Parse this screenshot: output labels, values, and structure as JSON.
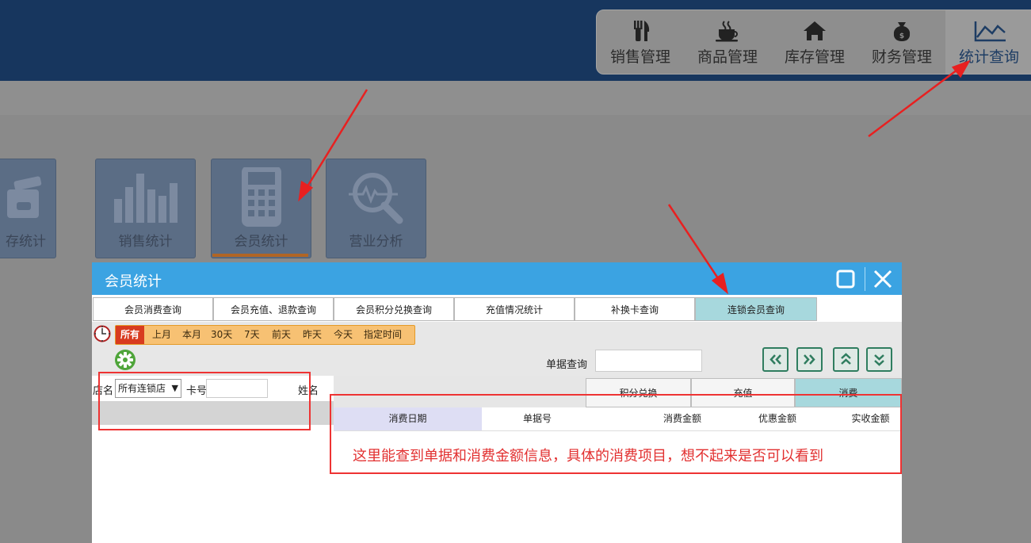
{
  "main_nav": {
    "items": [
      {
        "label": "销售管理",
        "icon": "fork-knife-icon"
      },
      {
        "label": "商品管理",
        "icon": "coffee-cup-icon"
      },
      {
        "label": "库存管理",
        "icon": "house-icon"
      },
      {
        "label": "财务管理",
        "icon": "money-bag-icon"
      },
      {
        "label": "统计查询",
        "icon": "line-chart-icon"
      }
    ],
    "active": "统计查询"
  },
  "tiles": [
    {
      "label": "存统计",
      "icon": "wallet-icon"
    },
    {
      "label": "销售统计",
      "icon": "bar-chart-icon"
    },
    {
      "label": "会员统计",
      "icon": "calculator-icon"
    },
    {
      "label": "营业分析",
      "icon": "magnifier-pulse-icon"
    }
  ],
  "window": {
    "title": "会员统计",
    "tabs": [
      "会员消费查询",
      "会员充值、退款查询",
      "会员积分兑换查询",
      "充值情况统计",
      "补换卡查询",
      "连锁会员查询"
    ],
    "active_tab": "连锁会员查询",
    "date_filters": [
      "所有",
      "上月",
      "本月",
      "30天",
      "7天",
      "前天",
      "昨天",
      "今天",
      "指定时间"
    ],
    "active_date": "所有",
    "search": {
      "label": "单据查询",
      "value": ""
    },
    "nav_buttons": [
      "<<",
      ">>",
      "top",
      "bottom"
    ],
    "filter": {
      "store_label": "店名",
      "store_value": "所有连锁店",
      "card_label": "卡号",
      "card_value": "",
      "name_label": "姓名"
    },
    "sub_tabs": [
      "积分兑换",
      "充值",
      "消费"
    ],
    "active_sub_tab": "消费",
    "columns": [
      "消费日期",
      "单据号",
      "消费金额",
      "优惠金额",
      "实收金额"
    ]
  },
  "annotation": "这里能查到单据和消费金额信息，具体的消费项目，想不起来是否可以看到",
  "colors": {
    "topbar": "#17365e",
    "window_title": "#3ba3e2",
    "active_tab": "#a7d8dd",
    "date_bar": "#f7c173",
    "annotation": "#e23030"
  }
}
